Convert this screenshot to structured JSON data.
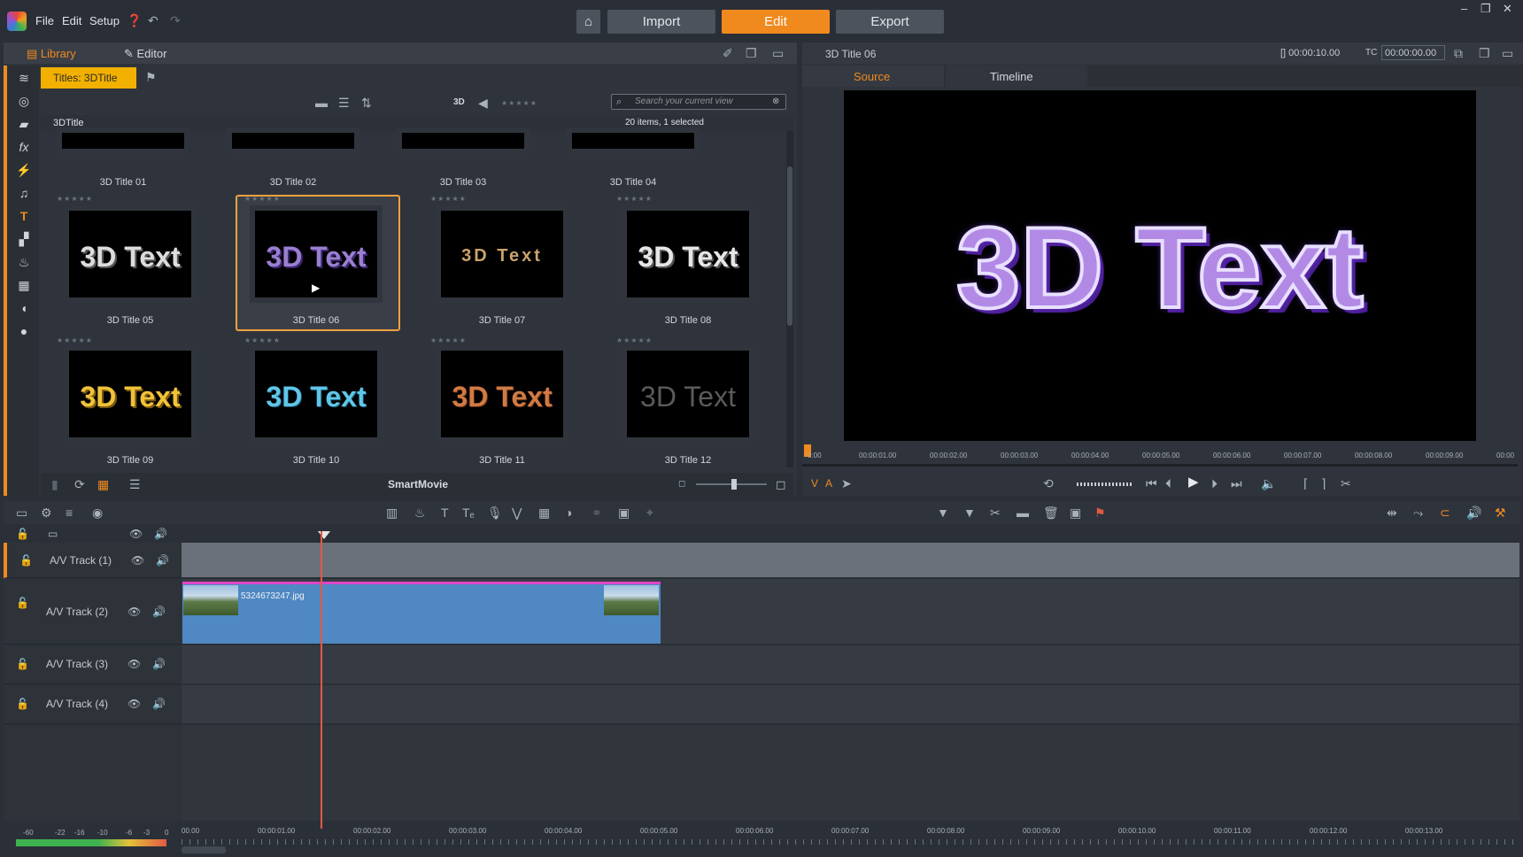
{
  "menu": {
    "file": "File",
    "edit": "Edit",
    "setup": "Setup"
  },
  "nav": {
    "import": "Import",
    "edit": "Edit",
    "export": "Export"
  },
  "library": {
    "tab_library": "Library",
    "tab_editor": "Editor",
    "chip": "Titles: 3DTitle",
    "view_3d": "3D",
    "search_placeholder": "Search your current view",
    "path": "3DTitle",
    "count": "20 items, 1 selected",
    "footer": "SmartMovie",
    "top_row": [
      "3D Title 01",
      "3D Title 02",
      "3D Title 03",
      "3D Title 04"
    ],
    "items": [
      {
        "label": "3D Title 05",
        "text": "3D Text",
        "color": "#dcdcdc"
      },
      {
        "label": "3D Title 06",
        "text": "3D Text",
        "color": "#9a7fd0",
        "selected": true
      },
      {
        "label": "3D Title 07",
        "text": "3D Text",
        "color": "#c9a36a"
      },
      {
        "label": "3D Title 08",
        "text": "3D Text",
        "color": "#e6e6e6"
      },
      {
        "label": "3D Title 09",
        "text": "3D Text",
        "color": "#f0c23a"
      },
      {
        "label": "3D Title 10",
        "text": "3D Text",
        "color": "#5fc6e8"
      },
      {
        "label": "3D Title 11",
        "text": "3D Text",
        "color": "#d07a45"
      },
      {
        "label": "3D Title 12",
        "text": "3D Text",
        "color": "#5a5a5a"
      }
    ],
    "stars": "★★★★★"
  },
  "preview": {
    "title": "3D Title 06",
    "duration": "00:00:10.00",
    "tc_label": "TC",
    "timecode": "00:00:00.00",
    "tab_source": "Source",
    "tab_timeline": "Timeline",
    "screen_text": "3D Text",
    "va_v": "V",
    "va_a": "A",
    "ruler": [
      "0:00",
      "00:00:01.00",
      "00:00:02.00",
      "00:00:03.00",
      "00:00:04.00",
      "00:00:05.00",
      "00:00:06.00",
      "00:00:07.00",
      "00:00:08.00",
      "00:00:09.00",
      "00:00"
    ]
  },
  "timeline": {
    "tracks": [
      "A/V Track (1)",
      "A/V Track (2)",
      "A/V Track (3)",
      "A/V Track (4)"
    ],
    "clip_name": "5324673247.jpg",
    "ruler": [
      "00.00",
      "00:00:01.00",
      "00:00:02.00",
      "00:00:03.00",
      "00:00:04.00",
      "00:00:05.00",
      "00:00:06.00",
      "00:00:07.00",
      "00:00:08.00",
      "00:00:09.00",
      "00:00:10.00",
      "00:00:11.00",
      "00:00:12.00",
      "00:00:13.00"
    ],
    "meter_labels": [
      "-60",
      "-22",
      "-16",
      "-10",
      "-6",
      "-3",
      "0"
    ]
  },
  "colors": {
    "accent": "#f08a1e",
    "chip": "#f2b000",
    "clip": "#4f88c2",
    "playhead": "#e05a45"
  }
}
